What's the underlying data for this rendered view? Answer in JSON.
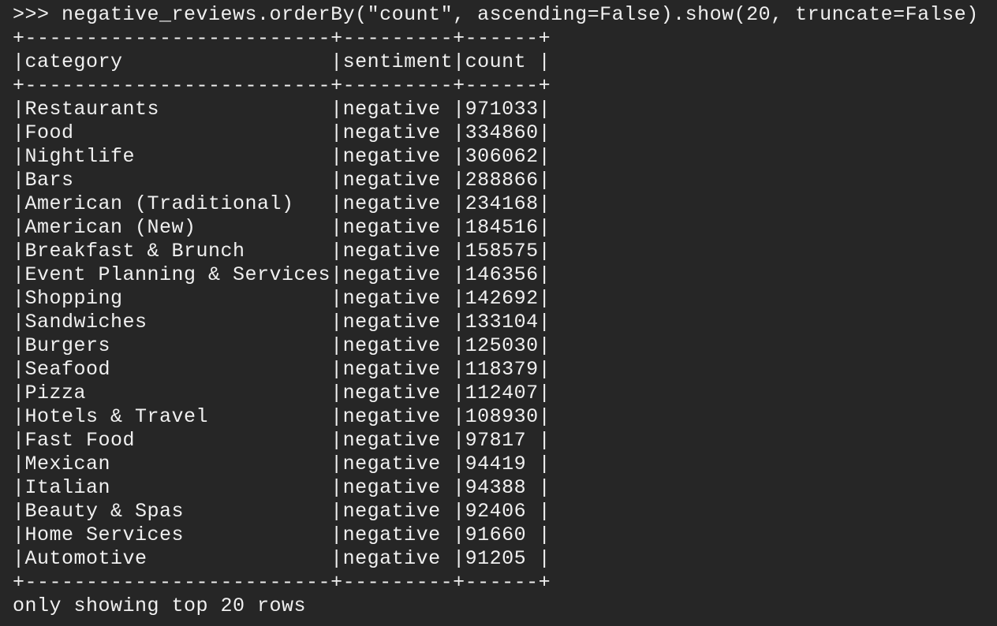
{
  "terminal": {
    "command_line": ">>> negative_reviews.orderBy(\"count\", ascending=False).show(20, truncate=False)",
    "border_line": "+-------------------------+---------+------+",
    "header_line": "|category                 |sentiment|count |",
    "rows": [
      "|Restaurants              |negative |971033|",
      "|Food                     |negative |334860|",
      "|Nightlife                |negative |306062|",
      "|Bars                     |negative |288866|",
      "|American (Traditional)   |negative |234168|",
      "|American (New)           |negative |184516|",
      "|Breakfast & Brunch       |negative |158575|",
      "|Event Planning & Services|negative |146356|",
      "|Shopping                 |negative |142692|",
      "|Sandwiches               |negative |133104|",
      "|Burgers                  |negative |125030|",
      "|Seafood                  |negative |118379|",
      "|Pizza                    |negative |112407|",
      "|Hotels & Travel          |negative |108930|",
      "|Fast Food                |negative |97817 |",
      "|Mexican                  |negative |94419 |",
      "|Italian                  |negative |94388 |",
      "|Beauty & Spas            |negative |92406 |",
      "|Home Services            |negative |91660 |",
      "|Automotive               |negative |91205 |"
    ],
    "footer_text": "only showing top 20 rows"
  }
}
